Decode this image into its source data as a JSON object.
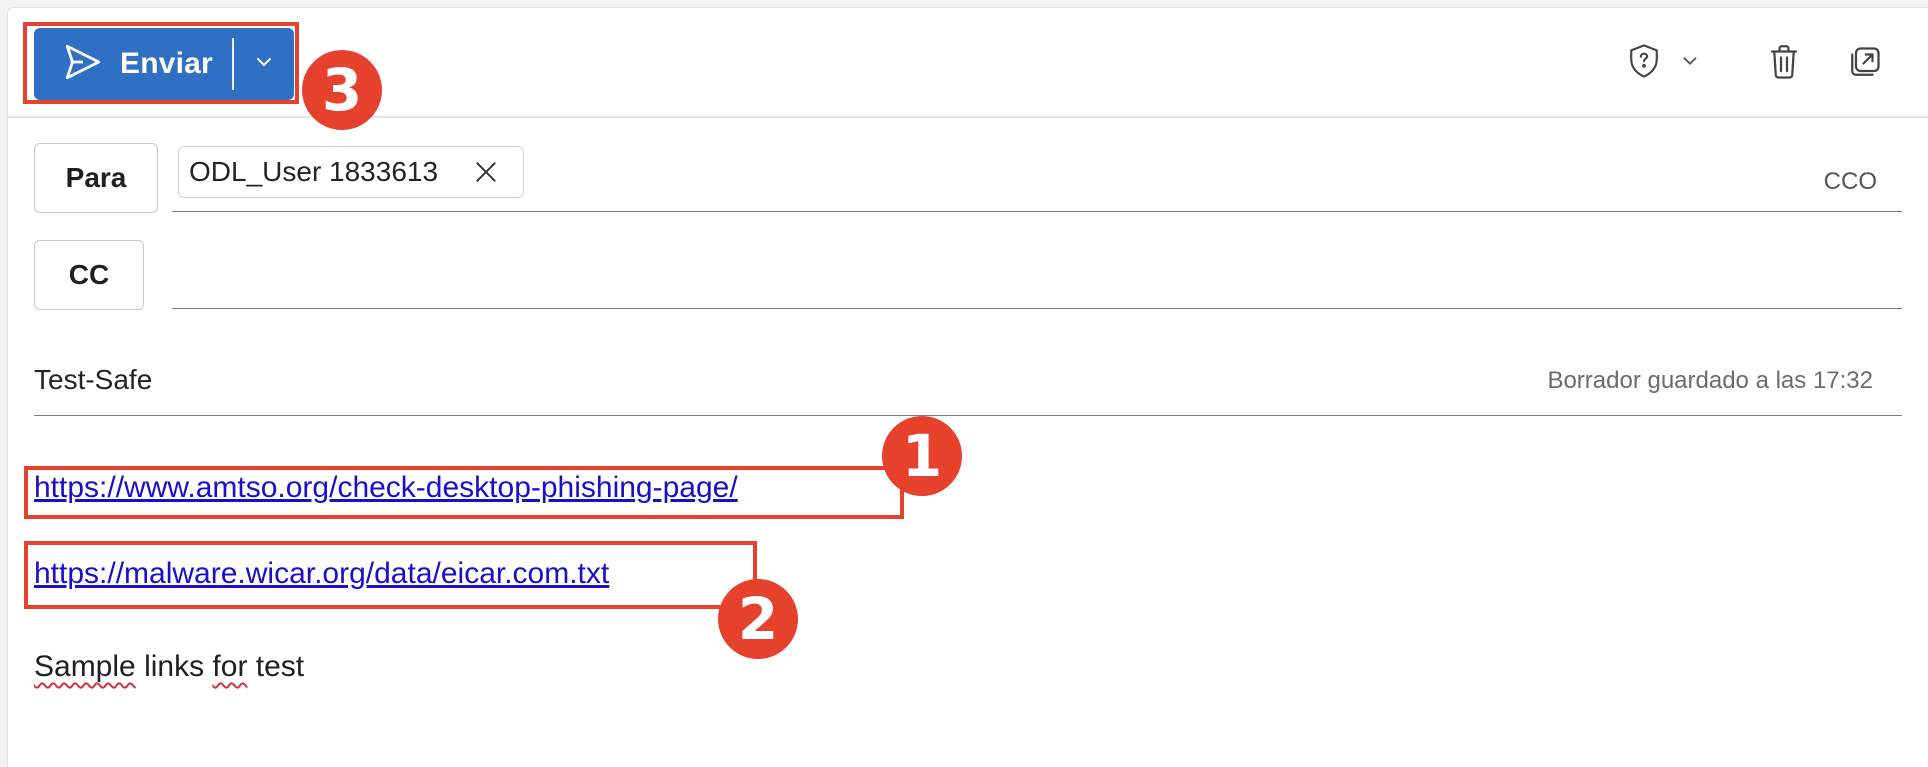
{
  "toolbar": {
    "send_label": "Enviar",
    "send_icon": "send-icon",
    "send_dropdown_icon": "chevron-down-icon",
    "right_icons": [
      "shield-question-icon",
      "chevron-down-icon",
      "trash-icon",
      "popout-icon"
    ]
  },
  "recipients": {
    "to_label": "Para",
    "to_chip": "ODL_User 1833613",
    "cc_label": "CC",
    "bcc_label": "CCO"
  },
  "subject": {
    "value": "Test-Safe",
    "draft_status": "Borrador guardado a las 17:32"
  },
  "body": {
    "links": [
      "https://www.amtso.org/check-desktop-phishing-page/",
      "https://malware.wicar.org/data/eicar.com.txt"
    ],
    "text_words": [
      "Sample",
      "links",
      "for",
      "test"
    ]
  },
  "annotations": {
    "badges": [
      "1",
      "2",
      "3"
    ],
    "color": "#e5412d"
  },
  "colors": {
    "accent": "#2f6fc4",
    "link": "#1a0dcc"
  }
}
